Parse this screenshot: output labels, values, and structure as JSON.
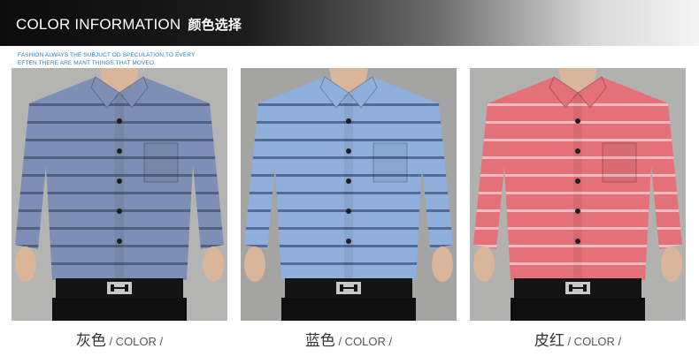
{
  "header": {
    "title_en": "COLOR INFORMATION",
    "title_cn": "颜色选择"
  },
  "tagline": {
    "line1": "FASHION ALWAYS THE  SUBJUCT OD SPECULATION,TO EVERY",
    "line2": "EFTEN THERE ARE MANT THINGS THAT MOVEO."
  },
  "products": [
    {
      "color_cn": "灰色",
      "suffix": " / COLOR /",
      "shirt_color": "#7d8fb4",
      "stripe_color": "#4b5978",
      "bg": "#b4b4b2"
    },
    {
      "color_cn": "蓝色",
      "suffix": " / COLOR /",
      "shirt_color": "#8fb0dc",
      "stripe_color": "#4a5f8a",
      "bg": "#a4a5a3"
    },
    {
      "color_cn": "皮红",
      "suffix": " / COLOR /",
      "shirt_color": "#e4707a",
      "stripe_color": "#f5c9cc",
      "bg": "#b1b1af"
    }
  ]
}
